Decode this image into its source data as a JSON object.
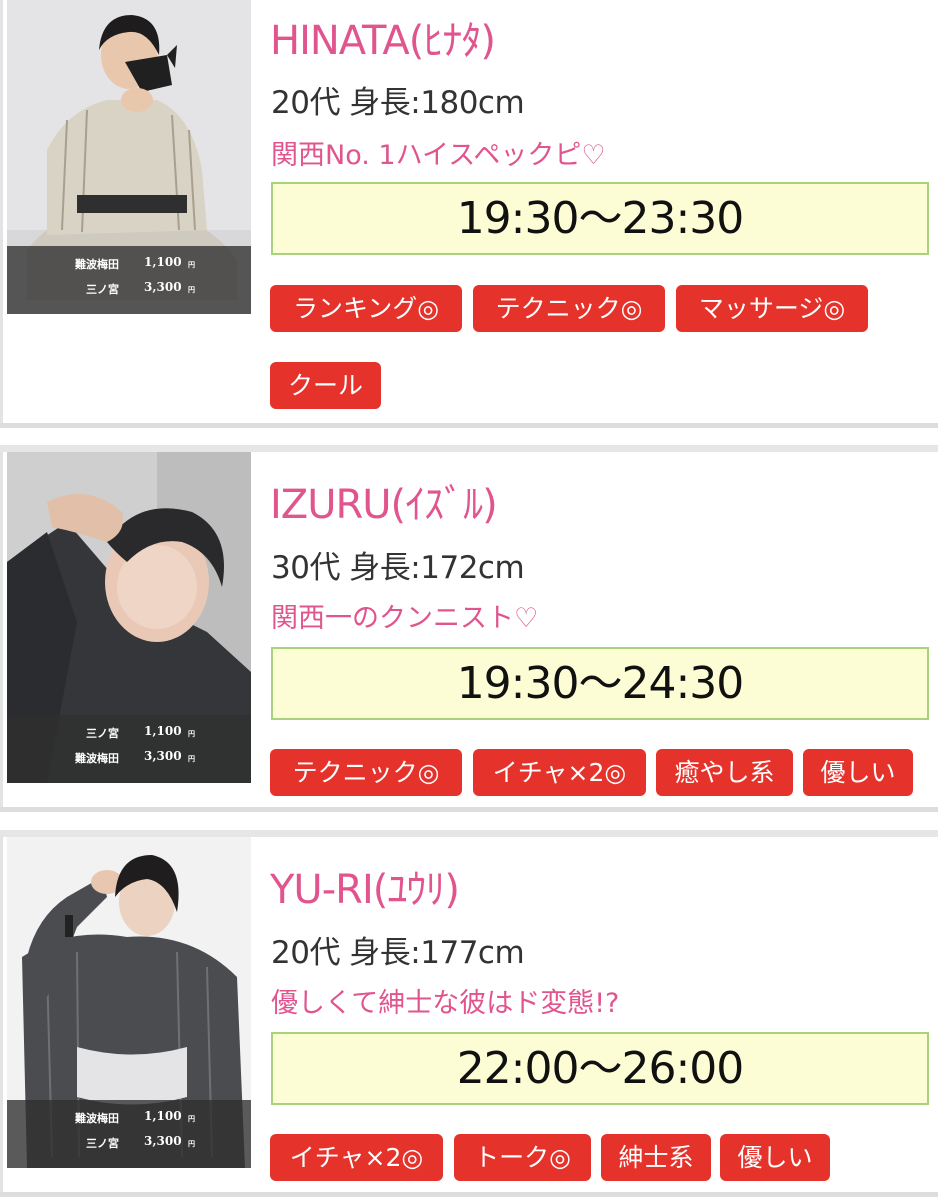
{
  "casts": [
    {
      "name": "HINATA(ﾋﾅﾀ)",
      "meta": "20代 身長:180cm",
      "catch": "関西No. 1ハイスペックピ♡",
      "time": "19:30〜23:30",
      "prices": [
        {
          "area": "難波梅田",
          "price": "1,100",
          "yen": "円"
        },
        {
          "area": "三ノ宮",
          "price": "3,300",
          "yen": "円"
        }
      ],
      "tags": [
        "ランキング◎",
        "テクニック◎",
        "マッサージ◎",
        "クール"
      ]
    },
    {
      "name": "IZURU(ｲｽﾞﾙ)",
      "meta": "30代 身長:172cm",
      "catch": "関西一のクンニスト♡",
      "time": "19:30〜24:30",
      "prices": [
        {
          "area": "三ノ宮",
          "price": "1,100",
          "yen": "円"
        },
        {
          "area": "難波梅田",
          "price": "3,300",
          "yen": "円"
        }
      ],
      "tags": [
        "テクニック◎",
        "イチャ×2◎",
        "癒やし系",
        "優しい"
      ]
    },
    {
      "name": "YU-RI(ﾕｳﾘ)",
      "meta": "20代 身長:177cm",
      "catch": "優しくて紳士な彼はド変態!?",
      "time": "22:00〜26:00",
      "prices": [
        {
          "area": "難波梅田",
          "price": "1,100",
          "yen": "円"
        },
        {
          "area": "三ノ宮",
          "price": "3,300",
          "yen": "円"
        }
      ],
      "tags": [
        "イチャ×2◎",
        "トーク◎",
        "紳士系",
        "優しい"
      ]
    }
  ],
  "colors": {
    "name_pink": "#e0558e",
    "tag_red": "#e5322b",
    "time_bg": "#fdfdd5",
    "time_border": "#a8d27c"
  }
}
